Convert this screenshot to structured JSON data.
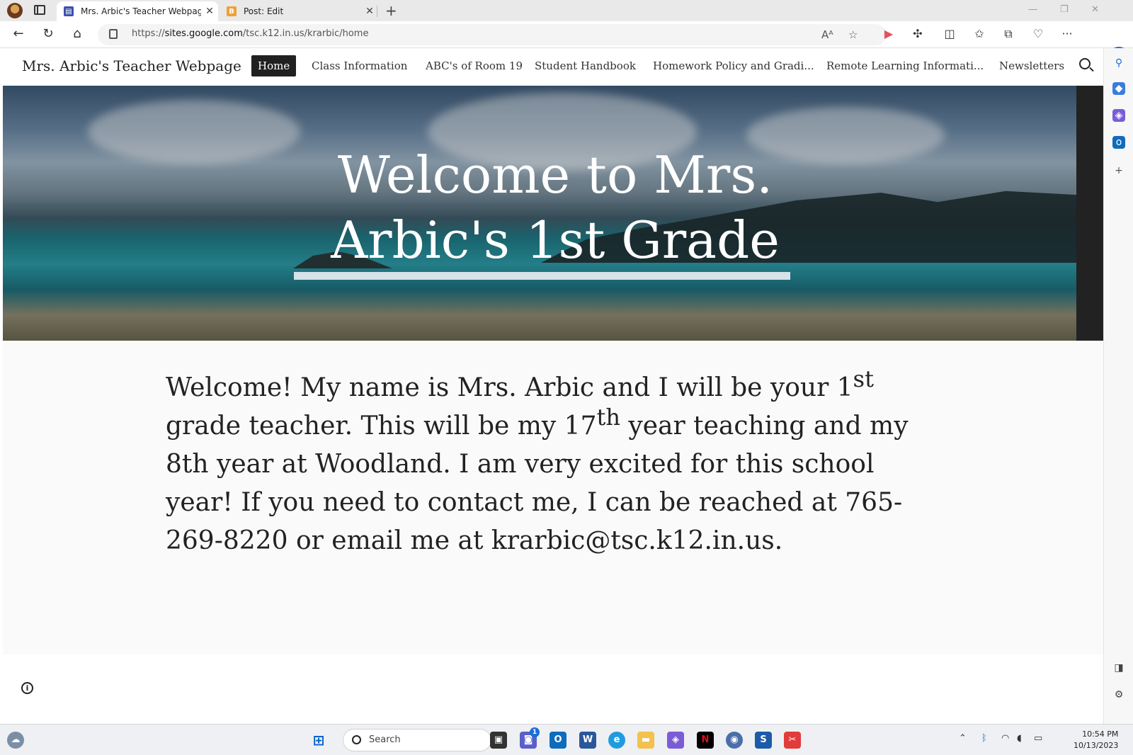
{
  "browser": {
    "tabs": [
      {
        "title": "Mrs. Arbic's Teacher Webpage",
        "active": true
      },
      {
        "title": "Post: Edit",
        "active": false
      }
    ],
    "new_tab": "+",
    "url_prefix": "https://",
    "url_host": "sites.google.com",
    "url_path": "/tsc.k12.in.us/krarbic/home",
    "read_aloud": "Aᴬ",
    "more": "···"
  },
  "site": {
    "title": "Mrs. Arbic's Teacher Webpage",
    "nav": [
      "Home",
      "Class Information",
      "ABC's of Room 19",
      "Student Handbook",
      "Homework Policy and Gradi...",
      "Remote Learning Informati...",
      "Newsletters"
    ]
  },
  "hero": {
    "heading_line1": "Welcome to Mrs.",
    "heading_line2": "Arbic's 1st Grade"
  },
  "content": {
    "p1": "Welcome! My name is Mrs. Arbic and I will be your 1",
    "sup1": "st",
    "p2": " grade teacher. This will be my 17",
    "sup2": "th",
    "p3": " year teaching and my 8th year at Woodland. I am very excited for this school year! If you need to contact me, I can be reached at 765-269-8220  or email me at krarbic@tsc.k12.in.us."
  },
  "taskbar": {
    "search_label": "Search",
    "chat_badge": "1",
    "time": "10:54 PM",
    "date": "10/13/2023"
  }
}
